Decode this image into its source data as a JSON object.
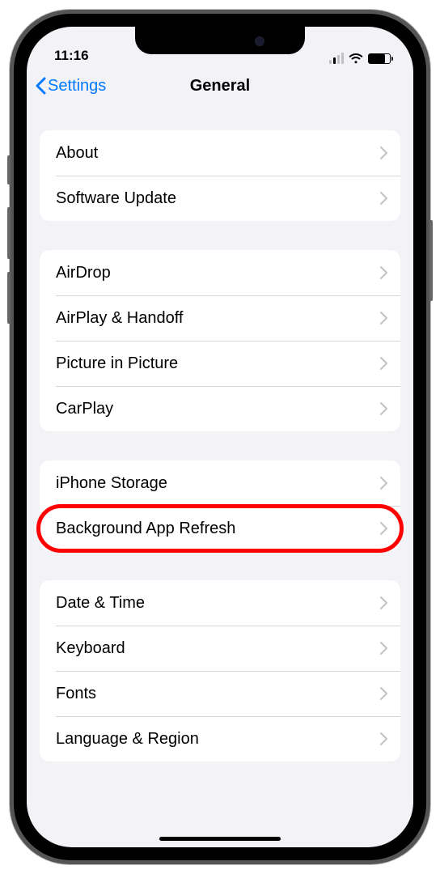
{
  "statusBar": {
    "time": "11:16"
  },
  "nav": {
    "back": "Settings",
    "title": "General"
  },
  "groups": [
    {
      "rows": [
        "About",
        "Software Update"
      ]
    },
    {
      "rows": [
        "AirDrop",
        "AirPlay & Handoff",
        "Picture in Picture",
        "CarPlay"
      ]
    },
    {
      "rows": [
        "iPhone Storage",
        "Background App Refresh"
      ]
    },
    {
      "rows": [
        "Date & Time",
        "Keyboard",
        "Fonts",
        "Language & Region"
      ]
    }
  ],
  "highlighted": "Background App Refresh",
  "colors": {
    "accent": "#007aff",
    "highlight": "#ff0000",
    "background": "#f2f2f7"
  }
}
